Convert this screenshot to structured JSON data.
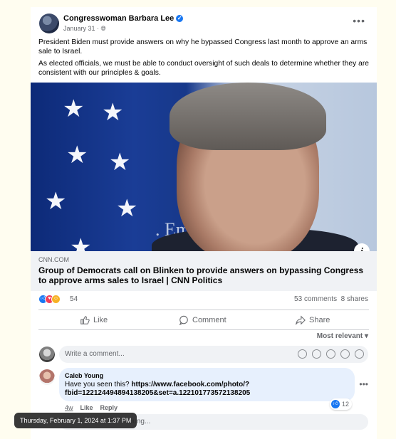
{
  "post": {
    "author": "Congresswoman Barbara Lee",
    "date": "January 31",
    "meta_sep": " · ",
    "paragraph1": "President Biden must provide answers on why he bypassed Congress last month to approve an arms sale to Israel.",
    "paragraph2": "As elected officials, we must be able to conduct oversight of such deals to determine whether they are consistent with our principles & goals."
  },
  "photo_text": ". Em             usalem",
  "link": {
    "domain": "CNN.COM",
    "title": "Group of Democrats call on Blinken to provide answers on bypassing Congress to approve arms sales to Israel | CNN Politics"
  },
  "stats": {
    "reactions": "54",
    "comments": "53 comments",
    "shares": "8 shares"
  },
  "actions": {
    "like": "Like",
    "comment": "Comment",
    "share": "Share"
  },
  "sort": "Most relevant ▾",
  "comment_input": {
    "placeholder": "Write a comment..."
  },
  "comment": {
    "name": "Caleb Young",
    "text": "Have you seen this? ",
    "link": "https://www.facebook.com/photo/?fbid=122124494894138205&set=a.122101773572138205",
    "time": "4w",
    "like": "Like",
    "reply": "Reply",
    "reaction_count": "12"
  },
  "reply_input": {
    "placeholder": "Young..."
  },
  "tooltip": "Thursday, February 1, 2024 at 1:37 PM",
  "colors": {
    "accent": "#1877f2",
    "muted": "#65676b"
  }
}
